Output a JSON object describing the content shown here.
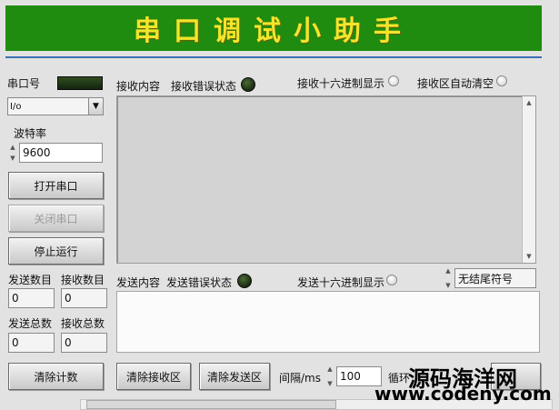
{
  "header": {
    "title": "串口调试小助手"
  },
  "port": {
    "label": "串口号",
    "selected": "I/o"
  },
  "baud": {
    "label": "波特率",
    "value": "9600"
  },
  "buttons": {
    "open_port": "打开串口",
    "close_port": "关闭串口",
    "stop": "停止运行",
    "clear_count": "清除计数",
    "clear_receive": "清除接收区",
    "clear_send": "清除发送区"
  },
  "counters": {
    "send_count_label": "发送数目",
    "send_count_value": "0",
    "recv_count_label": "接收数目",
    "recv_count_value": "0",
    "send_total_label": "发送总数",
    "send_total_value": "0",
    "recv_total_label": "接收总数",
    "recv_total_value": "0"
  },
  "receive": {
    "content_label": "接收内容",
    "error_label": "接收错误状态",
    "hex_label": "接收十六进制显示",
    "auto_clear_label": "接收区自动清空"
  },
  "send": {
    "content_label": "发送内容",
    "error_label": "发送错误状态",
    "hex_label": "发送十六进制显示",
    "terminator_value": "无结尾符号"
  },
  "interval": {
    "label": "间隔/ms",
    "value": "100"
  },
  "loop": {
    "label": "循环"
  },
  "watermark": {
    "site_cn": "源码海洋网",
    "url": "www.codeny.com"
  },
  "colors": {
    "header_bg": "#1f8c0f",
    "header_text": "#f2e52c",
    "accent_line": "#3b6fb4"
  }
}
